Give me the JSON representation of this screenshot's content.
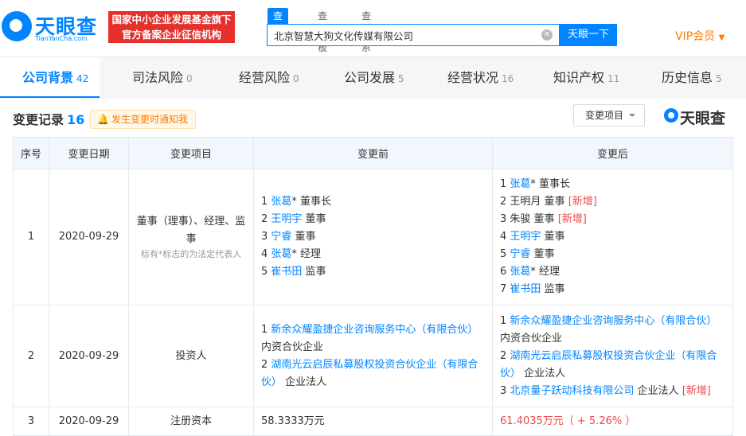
{
  "header": {
    "logo_text": "天眼查",
    "logo_sub": "TianYanCha.com",
    "badge_line1": "国家中小企业发展基金旗下",
    "badge_line2": "官方备案企业征信机构",
    "search_tabs": [
      "查公司",
      "查老板",
      "查关系"
    ],
    "search_value": "北京智慧大狗文化传媒有限公司",
    "search_button": "天眼一下",
    "vip_label": "VIP会员"
  },
  "nav": [
    {
      "label": "公司背景",
      "count": "42"
    },
    {
      "label": "司法风险",
      "count": "0"
    },
    {
      "label": "经营风险",
      "count": "0"
    },
    {
      "label": "公司发展",
      "count": "5"
    },
    {
      "label": "经营状况",
      "count": "16"
    },
    {
      "label": "知识产权",
      "count": "11"
    },
    {
      "label": "历史信息",
      "count": "5"
    }
  ],
  "section": {
    "title": "变更记录",
    "count": "16",
    "notify_label": "发生变更时通知我",
    "dropdown_label": "变更项目",
    "watermark": "天眼查"
  },
  "table": {
    "headers": [
      "序号",
      "变更日期",
      "变更项目",
      "变更前",
      "变更后"
    ],
    "rows": [
      {
        "index": "1",
        "date": "2020-09-29",
        "item": "董事（理事）、经理、监事",
        "item_note": "标有*标志的为法定代表人",
        "before": [
          {
            "n": "1",
            "name": "张葛",
            "star": "*",
            "role": "董事长"
          },
          {
            "n": "2",
            "name": "王明宇",
            "star": "",
            "role": "董事"
          },
          {
            "n": "3",
            "name": "宁睿",
            "star": "",
            "role": "董事"
          },
          {
            "n": "4",
            "name": "张葛",
            "star": "*",
            "role": "经理"
          },
          {
            "n": "5",
            "name": "崔书田",
            "star": "",
            "role": "监事"
          }
        ],
        "after": [
          {
            "n": "1",
            "name": "张葛",
            "star": "*",
            "role": "董事长",
            "link": true
          },
          {
            "n": "2",
            "name": "王明月",
            "star": "",
            "role": "董事",
            "link": false,
            "tag": "[新增]"
          },
          {
            "n": "3",
            "name": "朱骏",
            "star": "",
            "role": "董事",
            "link": false,
            "tag": "[新增]"
          },
          {
            "n": "4",
            "name": "王明宇",
            "star": "",
            "role": "董事",
            "link": true
          },
          {
            "n": "5",
            "name": "宁睿",
            "star": "",
            "role": "董事",
            "link": true
          },
          {
            "n": "6",
            "name": "张葛",
            "star": "*",
            "role": "经理",
            "link": true
          },
          {
            "n": "7",
            "name": "崔书田",
            "star": "",
            "role": "监事",
            "link": true
          }
        ]
      },
      {
        "index": "2",
        "date": "2020-09-29",
        "item": "投资人",
        "before": [
          {
            "n": "1",
            "name": "新余众耀盈捷企业咨询服务中心（有限合伙）",
            "type": "内资合伙企业"
          },
          {
            "n": "2",
            "name": "湖南光云启辰私募股权投资合伙企业（有限合伙）",
            "type": "企业法人"
          }
        ],
        "after": [
          {
            "n": "1",
            "name": "新余众耀盈捷企业咨询服务中心（有限合伙）",
            "type": "内资合伙企业"
          },
          {
            "n": "2",
            "name": "湖南光云启辰私募股权投资合伙企业（有限合伙）",
            "type": "企业法人"
          },
          {
            "n": "3",
            "name": "北京量子跃动科技有限公司",
            "type": "企业法人",
            "tag": "[新增]"
          }
        ]
      },
      {
        "index": "3",
        "date": "2020-09-29",
        "item": "注册资本",
        "before_text": "58.3333万元",
        "after_text": "61.4035万元（ + 5.26% ）"
      }
    ]
  }
}
